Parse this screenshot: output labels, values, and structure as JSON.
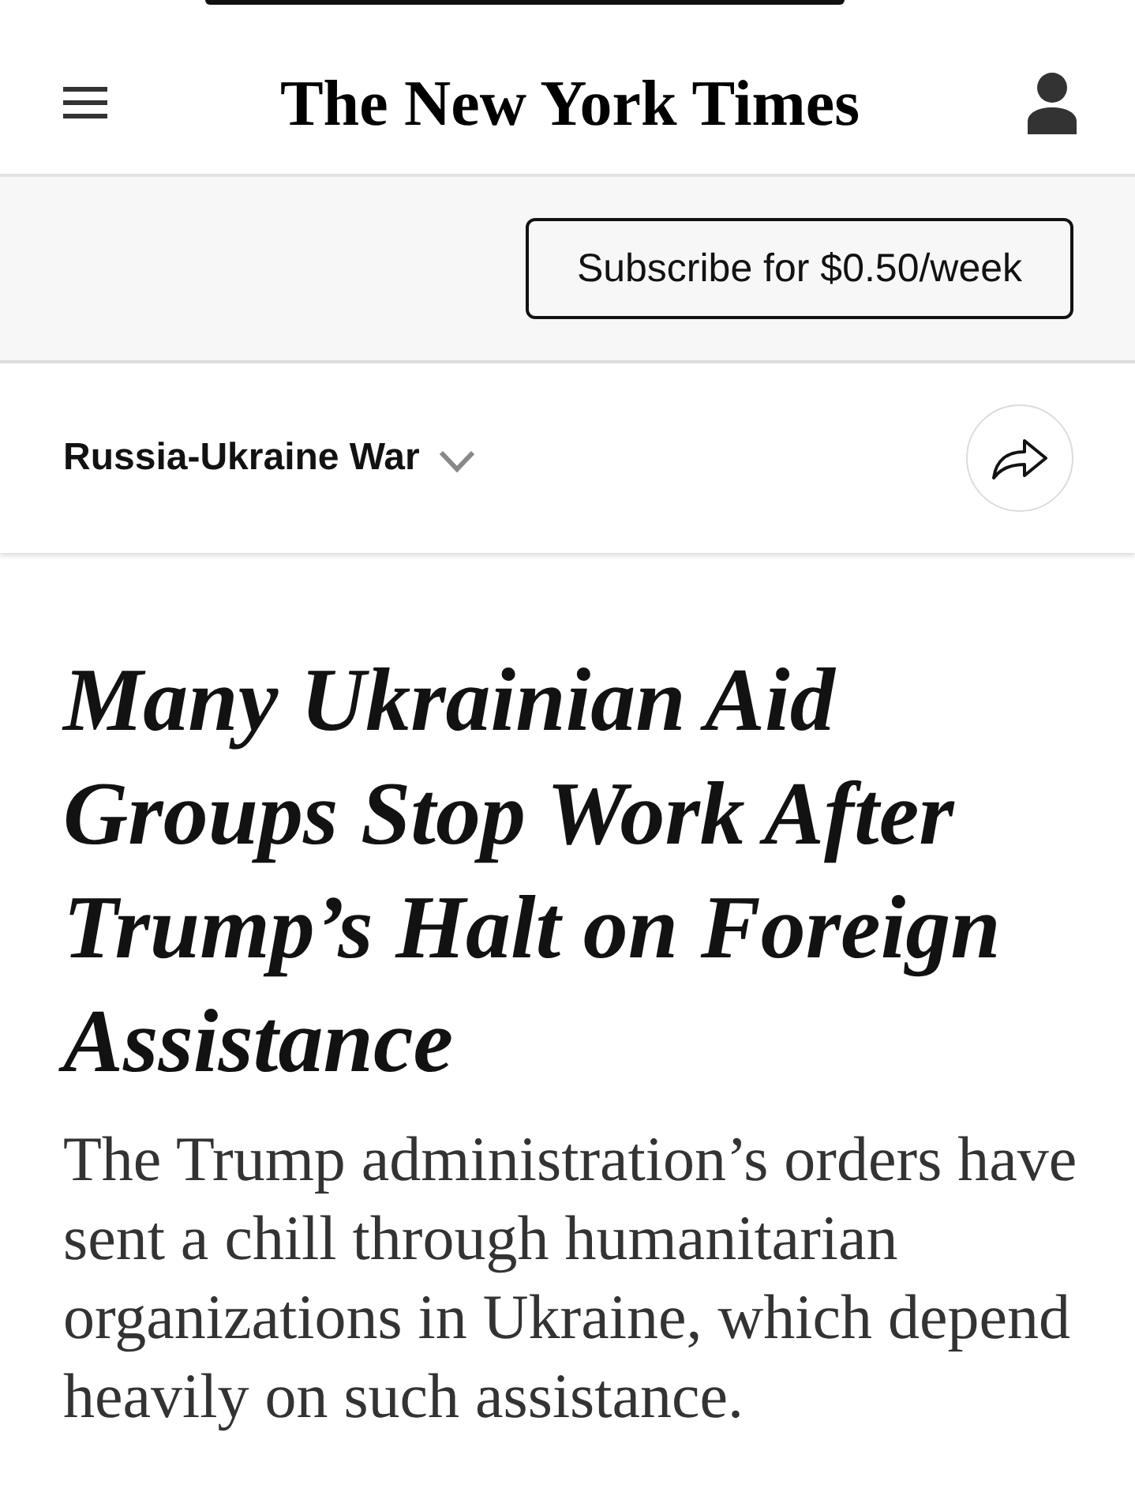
{
  "header": {
    "logo": "The New York Times"
  },
  "subscribe_bar": {
    "button": "Subscribe for $0.50/week"
  },
  "section_bar": {
    "label": "Russia-Ukraine War",
    "expanded": false
  },
  "article": {
    "headline": "Many Ukrainian Aid Groups Stop Work After Trump’s Halt on Foreign Assistance",
    "summary": "The Trump administration’s orders have sent a chill through humanitarian organizations in Ukraine, which depend heavily on such assistance."
  }
}
